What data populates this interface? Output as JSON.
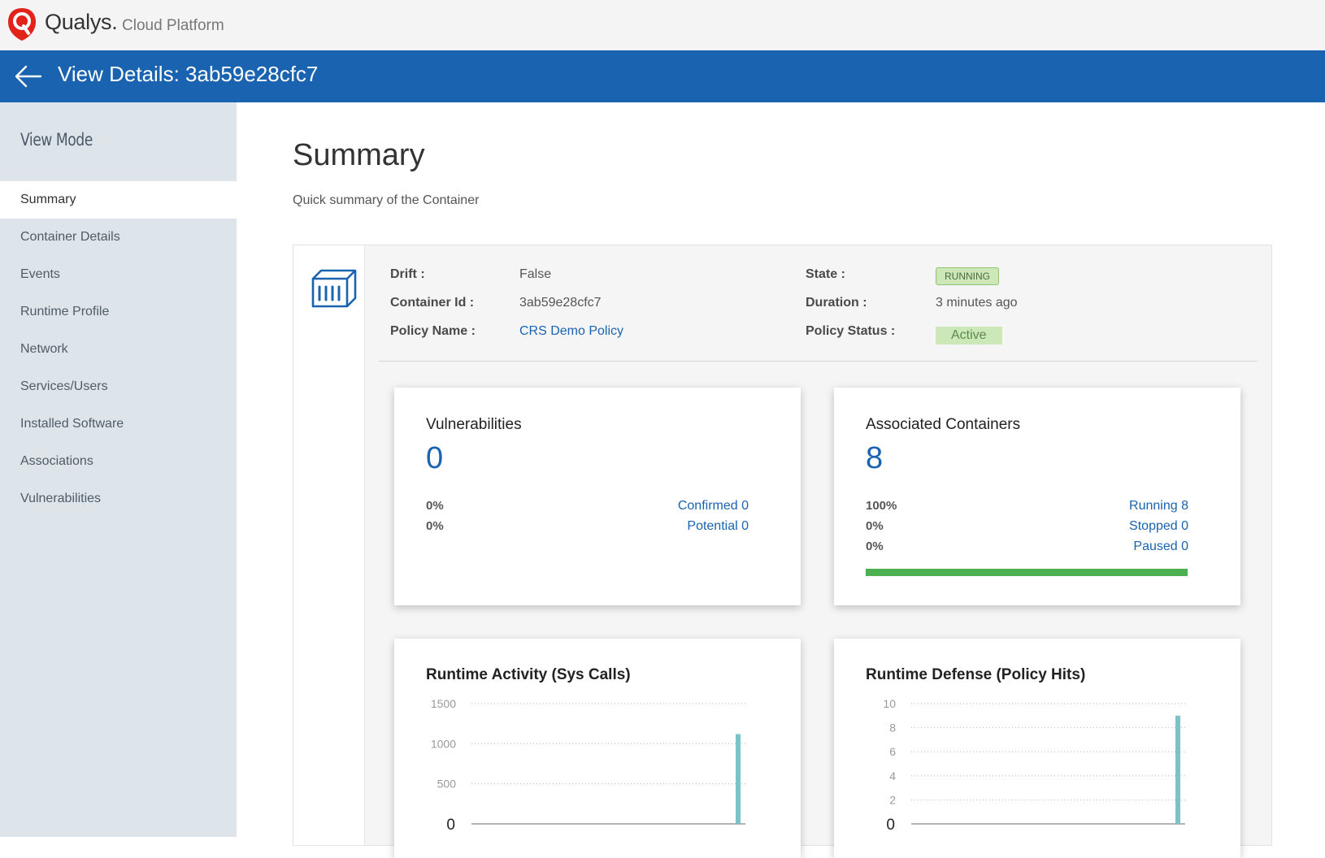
{
  "app": {
    "brand": "Qualys.",
    "brand_sub": "Cloud Platform",
    "logo_icon": "qualys-shield-icon",
    "back_icon": "arrow-left-icon",
    "title": "View Details: 3ab59e28cfc7",
    "accent": "#1a63b0"
  },
  "sidebar": {
    "heading": "View Mode",
    "items": [
      {
        "label": "Summary",
        "active": true
      },
      {
        "label": "Container Details"
      },
      {
        "label": "Events"
      },
      {
        "label": "Runtime Profile"
      },
      {
        "label": "Network"
      },
      {
        "label": "Services/Users"
      },
      {
        "label": "Installed Software"
      },
      {
        "label": "Associations"
      },
      {
        "label": "Vulnerabilities"
      }
    ]
  },
  "summary": {
    "title": "Summary",
    "subtitle": "Quick summary of the Container",
    "icon": "container-icon",
    "drift_label": "Drift :",
    "drift_value": "False",
    "container_id_label": "Container Id :",
    "container_id_value": "3ab59e28cfc7",
    "policy_name_label": "Policy Name :",
    "policy_name_value": "CRS Demo Policy",
    "state_label": "State :",
    "state_value": "RUNNING",
    "duration_label": "Duration :",
    "duration_value": "3 minutes ago",
    "policy_status_label": "Policy Status :",
    "policy_status_value": "Active"
  },
  "vulnerabilities": {
    "title": "Vulnerabilities",
    "count": "0",
    "rows": [
      {
        "pct": "0%",
        "label": "Confirmed 0"
      },
      {
        "pct": "0%",
        "label": "Potential 0"
      }
    ]
  },
  "associated": {
    "title": "Associated Containers",
    "count": "8",
    "rows": [
      {
        "pct": "100%",
        "label": "Running 8"
      },
      {
        "pct": "0%",
        "label": "Stopped 0"
      },
      {
        "pct": "0%",
        "label": "Paused 0"
      }
    ],
    "running_fraction": 1.0,
    "bar_color": "#4caf50"
  },
  "chart_data": [
    {
      "type": "bar",
      "title": "Runtime Activity (Sys Calls)",
      "yticks": [
        "1500",
        "1000",
        "500",
        "0"
      ],
      "ylim": [
        0,
        1500
      ],
      "grid": true,
      "values": [
        1120
      ],
      "color": "#7cc3c8"
    },
    {
      "type": "bar",
      "title": "Runtime Defense (Policy Hits)",
      "yticks": [
        "10",
        "8",
        "6",
        "4",
        "2",
        "0"
      ],
      "ylim": [
        0,
        10
      ],
      "grid": true,
      "values": [
        9
      ],
      "color": "#7cc3c8"
    }
  ]
}
